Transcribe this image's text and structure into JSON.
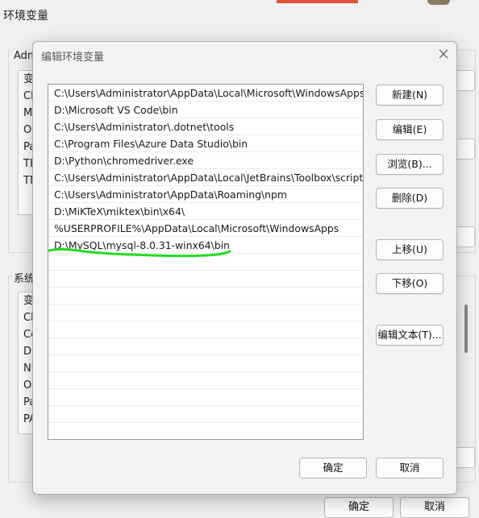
{
  "background_window": {
    "title": "环境变量",
    "user_section_label": "Adm",
    "system_section_label": "系统",
    "user_list_items": [
      "变",
      "Ch",
      "M",
      "On",
      "Pa",
      "TE",
      "TM"
    ],
    "system_list_items": [
      "变",
      "Ch",
      "Co",
      "Dr",
      "NU",
      "OS",
      "Pa",
      "PA"
    ],
    "ok_label": "确定",
    "cancel_label": "取消"
  },
  "dialog": {
    "title": "编辑环境变量",
    "paths": [
      "C:\\Users\\Administrator\\AppData\\Local\\Microsoft\\WindowsApps",
      "D:\\Microsoft VS Code\\bin",
      "C:\\Users\\Administrator\\.dotnet\\tools",
      "C:\\Program Files\\Azure Data Studio\\bin",
      "D:\\Python\\chromedriver.exe",
      "C:\\Users\\Administrator\\AppData\\Local\\JetBrains\\Toolbox\\scripts",
      "C:\\Users\\Administrator\\AppData\\Roaming\\npm",
      "D:\\MiKTeX\\miktex\\bin\\x64\\",
      "%USERPROFILE%\\AppData\\Local\\Microsoft\\WindowsApps",
      "D:\\MySQL\\mysql-8.0.31-winx64\\bin"
    ],
    "buttons": {
      "new": "新建(N)",
      "edit": "编辑(E)",
      "browse": "浏览(B)...",
      "delete": "删除(D)",
      "move_up": "上移(U)",
      "move_down": "下移(O)",
      "edit_text": "编辑文本(T)..."
    },
    "ok_label": "确定",
    "cancel_label": "取消"
  },
  "colors": {
    "annotation_underline": "#22dd22",
    "accent_bar": "#e0523a"
  }
}
